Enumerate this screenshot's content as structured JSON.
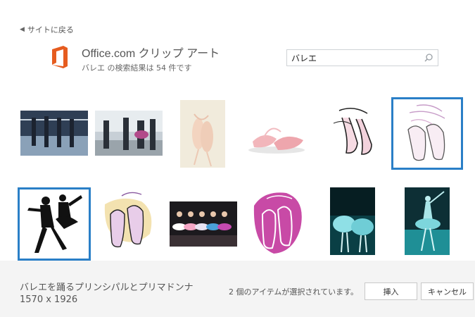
{
  "nav": {
    "back_label": "サイトに戻る"
  },
  "header": {
    "title": "Office.com クリップ アート",
    "results_summary": "バレエ の検索結果は 54 件です"
  },
  "search": {
    "value": "バレエ"
  },
  "results": {
    "row1": [
      {
        "icon": "dancers-at-barre-photo",
        "selected": false
      },
      {
        "icon": "dance-class-photo",
        "selected": false
      },
      {
        "icon": "pointe-shoes-hanging-photo",
        "selected": false
      },
      {
        "icon": "pink-pointe-shoes-photo",
        "selected": false
      },
      {
        "icon": "pointe-shoes-sketch-clipart",
        "selected": false
      },
      {
        "icon": "pointe-shoes-lineart-clipart",
        "selected": true
      }
    ],
    "row2": [
      {
        "icon": "principal-and-prima-clipart",
        "selected": true
      },
      {
        "icon": "slippers-on-yellow-clipart",
        "selected": false
      },
      {
        "icon": "girls-tutus-stage-photo",
        "selected": false
      },
      {
        "icon": "slippers-on-magenta-clipart",
        "selected": false
      },
      {
        "icon": "ballerinas-teal-photo",
        "selected": false
      },
      {
        "icon": "dancer-teal-photo",
        "selected": false
      }
    ]
  },
  "footer": {
    "item_name": "バレエを踊るプリンシパルとプリマドンナ",
    "item_size": "1570 x 1926",
    "selection_status": "2 個のアイテムが選択されています。",
    "insert_label": "挿入",
    "cancel_label": "キャンセル"
  },
  "colors": {
    "selection": "#2a7fc7",
    "office_logo": "#e65c1f",
    "footer_bg": "#f4f4f4"
  }
}
